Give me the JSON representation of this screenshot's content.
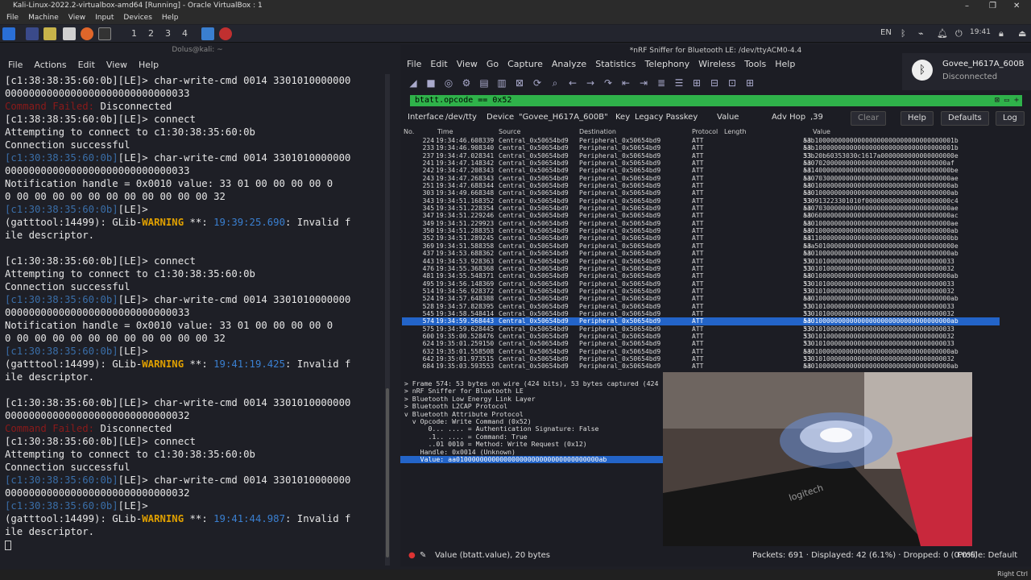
{
  "vbox": {
    "title": "Kali-Linux-2022.2-virtualbox-amd64 [Running] - Oracle VirtualBox : 1",
    "menu": [
      "File",
      "Machine",
      "View",
      "Input",
      "Devices",
      "Help"
    ],
    "taskbar_right": "Right Ctrl"
  },
  "panel": {
    "workspaces": [
      "1",
      "2",
      "3",
      "4"
    ],
    "lang": "EN",
    "clock": "19:41"
  },
  "terminal": {
    "title": "Dolus@kali: ~",
    "menu": [
      "File",
      "Actions",
      "Edit",
      "View",
      "Help"
    ],
    "lines": [
      [
        {
          "t": "[c1:38:38:35:60:0b][LE]> char-write-cmd 0014 3301010000000"
        }
      ],
      [
        {
          "t": "0000000000000000000000000000033"
        }
      ],
      [
        {
          "t": "Command Failed: ",
          "c": "fail"
        },
        {
          "t": "Disconnected"
        }
      ],
      [
        {
          "t": "[c1:38:38:35:60:0b][LE]> connect"
        }
      ],
      [
        {
          "t": "Attempting to connect to c1:30:38:35:60:0b"
        }
      ],
      [
        {
          "t": "Connection successful"
        }
      ],
      [
        {
          "t": "[c1:30:38:35:60:0b]",
          "c": "dim"
        },
        {
          "t": "[LE]> char-write-cmd 0014 3301010000000"
        }
      ],
      [
        {
          "t": "0000000000000000000000000000033"
        }
      ],
      [
        {
          "t": "Notification handle = 0x0010 value: 33 01 00 00 00 00 0"
        }
      ],
      [
        {
          "t": "0 00 00 00 00 00 00 00 00 00 00 00 32"
        }
      ],
      [
        {
          "t": "[c1:30:38:35:60:0b]",
          "c": "dim"
        },
        {
          "t": "[LE]>"
        }
      ],
      [
        {
          "t": "(gatttool:14499): GLib-"
        },
        {
          "t": "WARNING",
          "c": "warn"
        },
        {
          "t": " **: "
        },
        {
          "t": "19:39:25.690",
          "c": "time"
        },
        {
          "t": ": Invalid f"
        }
      ],
      [
        {
          "t": "ile descriptor."
        }
      ],
      [
        {
          "t": ""
        }
      ],
      [
        {
          "t": "[c1:30:38:35:60:0b][LE]> connect"
        }
      ],
      [
        {
          "t": "Attempting to connect to c1:30:38:35:60:0b"
        }
      ],
      [
        {
          "t": "Connection successful"
        }
      ],
      [
        {
          "t": "[c1:30:38:35:60:0b]",
          "c": "dim"
        },
        {
          "t": "[LE]> char-write-cmd 0014 3301010000000"
        }
      ],
      [
        {
          "t": "0000000000000000000000000000033"
        }
      ],
      [
        {
          "t": "Notification handle = 0x0010 value: 33 01 00 00 00 00 0"
        }
      ],
      [
        {
          "t": "0 00 00 00 00 00 00 00 00 00 00 00 32"
        }
      ],
      [
        {
          "t": "[c1:30:38:35:60:0b]",
          "c": "dim"
        },
        {
          "t": "[LE]>"
        }
      ],
      [
        {
          "t": "(gatttool:14499): GLib-"
        },
        {
          "t": "WARNING",
          "c": "warn"
        },
        {
          "t": " **: "
        },
        {
          "t": "19:41:19.425",
          "c": "time"
        },
        {
          "t": ": Invalid f"
        }
      ],
      [
        {
          "t": "ile descriptor."
        }
      ],
      [
        {
          "t": ""
        }
      ],
      [
        {
          "t": "[c1:30:38:35:60:0b][LE]> char-write-cmd 0014 3301010000000"
        }
      ],
      [
        {
          "t": "0000000000000000000000000000032"
        }
      ],
      [
        {
          "t": "Command Failed: ",
          "c": "fail"
        },
        {
          "t": "Disconnected"
        }
      ],
      [
        {
          "t": "[c1:30:38:35:60:0b][LE]> connect"
        }
      ],
      [
        {
          "t": "Attempting to connect to c1:30:38:35:60:0b"
        }
      ],
      [
        {
          "t": "Connection successful"
        }
      ],
      [
        {
          "t": "[c1:30:38:35:60:0b]",
          "c": "dim"
        },
        {
          "t": "[LE]> char-write-cmd 0014 3301010000000"
        }
      ],
      [
        {
          "t": "0000000000000000000000000000032"
        }
      ],
      [
        {
          "t": "[c1:30:38:35:60:0b]",
          "c": "dim"
        },
        {
          "t": "[LE]>"
        }
      ],
      [
        {
          "t": "(gatttool:14499): GLib-"
        },
        {
          "t": "WARNING",
          "c": "warn"
        },
        {
          "t": " **: "
        },
        {
          "t": "19:41:44.987",
          "c": "time"
        },
        {
          "t": ": Invalid f"
        }
      ],
      [
        {
          "t": "ile descriptor."
        }
      ]
    ]
  },
  "wireshark": {
    "title": "*nRF Sniffer for Bluetooth LE: /dev/ttyACM0-4.4",
    "menu": [
      "File",
      "Edit",
      "View",
      "Go",
      "Capture",
      "Analyze",
      "Statistics",
      "Telephony",
      "Wireless",
      "Tools",
      "Help"
    ],
    "filter": "btatt.opcode == 0x52",
    "opts": {
      "interface_label": "Interface",
      "interface_value": "/dev/tty",
      "device_label": "Device",
      "device_value": "\"Govee_H617A_600B\"",
      "key_label": "Key",
      "key_value": "Legacy Passkey",
      "value_label": "Value",
      "advhop_label": "Adv Hop",
      "advhop_value": ",39",
      "clear": "Clear",
      "help": "Help",
      "defaults": "Defaults",
      "log": "Log"
    },
    "columns": {
      "no": "No.",
      "time": "Time",
      "source": "Source",
      "destination": "Destination",
      "protocol": "Protocol",
      "length": "Length",
      "value": "Value"
    },
    "packets": [
      [
        "224",
        "19:34:46.608339",
        "Central_0x50654bd9",
        "Peripheral_0x50654bd9",
        "ATT",
        "53",
        "aab100000000000000000000000000000000001b"
      ],
      [
        "233",
        "19:34:46.908340",
        "Central_0x50654bd9",
        "Peripheral_0x50654bd9",
        "ATT",
        "53",
        "aab100000000000000000000000000000000001b"
      ],
      [
        "237",
        "19:34:47.028341",
        "Central_0x50654bd9",
        "Peripheral_0x50654bd9",
        "ATT",
        "53",
        "33b20b60353030c1617a0000000000000000000e"
      ],
      [
        "241",
        "19:34:47.148342",
        "Central_0x50654bd9",
        "Peripheral_0x50654bd9",
        "ATT",
        "53",
        "aa07020000000000000000000000000000000af"
      ],
      [
        "242",
        "19:34:47.208343",
        "Central_0x50654bd9",
        "Peripheral_0x50654bd9",
        "ATT",
        "53",
        "aa140000000000000000000000000000000000be"
      ],
      [
        "243",
        "19:34:47.268343",
        "Central_0x50654bd9",
        "Peripheral_0x50654bd9",
        "ATT",
        "53",
        "aa070300000000000000000000000000000000ae"
      ],
      [
        "251",
        "19:34:47.688344",
        "Central_0x50654bd9",
        "Peripheral_0x50654bd9",
        "ATT",
        "53",
        "aa010000000000000000000000000000000000ab"
      ],
      [
        "303",
        "19:34:49.668348",
        "Central_0x50654bd9",
        "Peripheral_0x50654bd9",
        "ATT",
        "53",
        "aa010000000000000000000000000000000000ab"
      ],
      [
        "343",
        "19:34:51.168352",
        "Central_0x50654bd9",
        "Peripheral_0x50654bd9",
        "ATT",
        "53",
        "330913223301010f0000000000000000000000c4"
      ],
      [
        "345",
        "19:34:51.228354",
        "Central_0x50654bd9",
        "Peripheral_0x50654bd9",
        "ATT",
        "53",
        "aa070300000000000000000000000000000000ae"
      ],
      [
        "347",
        "19:34:51.229246",
        "Central_0x50654bd9",
        "Peripheral_0x50654bd9",
        "ATT",
        "53",
        "aa060000000000000000000000000000000000ac"
      ],
      [
        "349",
        "19:34:51.229923",
        "Central_0x50654bd9",
        "Peripheral_0x50654bd9",
        "ATT",
        "53",
        "aa010000000000000000000000000000000000ae"
      ],
      [
        "350",
        "19:34:51.288353",
        "Central_0x50654bd9",
        "Peripheral_0x50654bd9",
        "ATT",
        "53",
        "aa010000000000000000000000000000000000ab"
      ],
      [
        "352",
        "19:34:51.289245",
        "Central_0x50654bd9",
        "Peripheral_0x50654bd9",
        "ATT",
        "53",
        "aa110000000000000000000000000000000000bb"
      ],
      [
        "369",
        "19:34:51.588358",
        "Central_0x50654bd9",
        "Peripheral_0x50654bd9",
        "ATT",
        "53",
        "aaa501000000000000000000000000000000000e"
      ],
      [
        "437",
        "19:34:53.688362",
        "Central_0x50654bd9",
        "Peripheral_0x50654bd9",
        "ATT",
        "53",
        "aa010000000000000000000000000000000000ab"
      ],
      [
        "443",
        "19:34:53.928363",
        "Central_0x50654bd9",
        "Peripheral_0x50654bd9",
        "ATT",
        "53",
        "330101000000000000000000000000000000033"
      ],
      [
        "476",
        "19:34:55.368368",
        "Central_0x50654bd9",
        "Peripheral_0x50654bd9",
        "ATT",
        "53",
        "330101000000000000000000000000000000032"
      ],
      [
        "481",
        "19:34:55.548371",
        "Central_0x50654bd9",
        "Peripheral_0x50654bd9",
        "ATT",
        "53",
        "aa010000000000000000000000000000000000ab"
      ],
      [
        "495",
        "19:34:56.148369",
        "Central_0x50654bd9",
        "Peripheral_0x50654bd9",
        "ATT",
        "53",
        "330101000000000000000000000000000000033"
      ],
      [
        "514",
        "19:34:56.928372",
        "Central_0x50654bd9",
        "Peripheral_0x50654bd9",
        "ATT",
        "53",
        "330101000000000000000000000000000000032"
      ],
      [
        "524",
        "19:34:57.648388",
        "Central_0x50654bd9",
        "Peripheral_0x50654bd9",
        "ATT",
        "53",
        "aa010000000000000000000000000000000000ab"
      ],
      [
        "528",
        "19:34:57.828395",
        "Central_0x50654bd9",
        "Peripheral_0x50654bd9",
        "ATT",
        "53",
        "330101000000000000000000000000000000033"
      ],
      [
        "545",
        "19:34:58.548414",
        "Central_0x50654bd9",
        "Peripheral_0x50654bd9",
        "ATT",
        "53",
        "330101000000000000000000000000000000032"
      ],
      [
        "574",
        "19:34:59.568443",
        "Central_0x50654bd9",
        "Peripheral_0x50654bd9",
        "ATT",
        "53",
        "aa010000000000000000000000000000000000ab"
      ],
      [
        "575",
        "19:34:59.628445",
        "Central_0x50654bd9",
        "Peripheral_0x50654bd9",
        "ATT",
        "53",
        "330101000000000000000000000000000000033"
      ],
      [
        "600",
        "19:35:00.528476",
        "Central_0x50654bd9",
        "Peripheral_0x50654bd9",
        "ATT",
        "53",
        "330101000000000000000000000000000000032"
      ],
      [
        "624",
        "19:35:01.259150",
        "Central_0x50654bd9",
        "Peripheral_0x50654bd9",
        "ATT",
        "53",
        "330101000000000000000000000000000000033"
      ],
      [
        "632",
        "19:35:01.558508",
        "Central_0x50654bd9",
        "Peripheral_0x50654bd9",
        "ATT",
        "53",
        "aa010000000000000000000000000000000000ab"
      ],
      [
        "642",
        "19:35:01.973515",
        "Central_0x50654bd9",
        "Peripheral_0x50654bd9",
        "ATT",
        "53",
        "330101000000000000000000000000000000032"
      ],
      [
        "684",
        "19:35:03.593553",
        "Central_0x50654bd9",
        "Peripheral_0x50654bd9",
        "ATT",
        "53",
        "aa010000000000000000000000000000000000ab"
      ]
    ],
    "selected_index": 24,
    "details": [
      " > Frame 574: 53 bytes on wire (424 bits), 53 bytes captured (424 b",
      " > nRF Sniffer for Bluetooth LE",
      " > Bluetooth Low Energy Link Layer",
      " > Bluetooth L2CAP Protocol",
      " v Bluetooth Attribute Protocol",
      "   v Opcode: Write Command (0x52)",
      "       0... .... = Authentication Signature: False",
      "       .1.. .... = Command: True",
      "       ..01 0010 = Method: Write Request (0x12)",
      "     Handle: 0x0014 (Unknown)",
      "     Value: aa010000000000000000000000000000000000ab"
    ],
    "details_selected": 10,
    "status": {
      "field": "Value (btatt.value), 20 bytes",
      "packets": "Packets: 691 · Displayed: 42 (6.1%) · Dropped: 0 (0.0%)",
      "profile": "Profile: Default"
    }
  },
  "notification": {
    "device": "Govee_H617A_600B",
    "state": "Disconnected"
  },
  "webcam": {
    "brand": "logitech"
  }
}
